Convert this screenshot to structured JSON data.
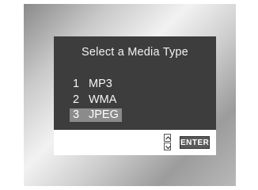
{
  "dialog": {
    "title": "Select a Media Type",
    "items": [
      {
        "number": "1",
        "label": "MP3"
      },
      {
        "number": "2",
        "label": "WMA"
      },
      {
        "number": "3",
        "label": "JPEG"
      }
    ],
    "selected_index": 2
  },
  "footer": {
    "nav_icon": "up-down-arrows-icon",
    "enter_label": "ENTER"
  },
  "colors": {
    "dialog_bg": "#3d3d3d",
    "highlight_bg": "#8b8b8b",
    "text": "#f2f2f2"
  }
}
